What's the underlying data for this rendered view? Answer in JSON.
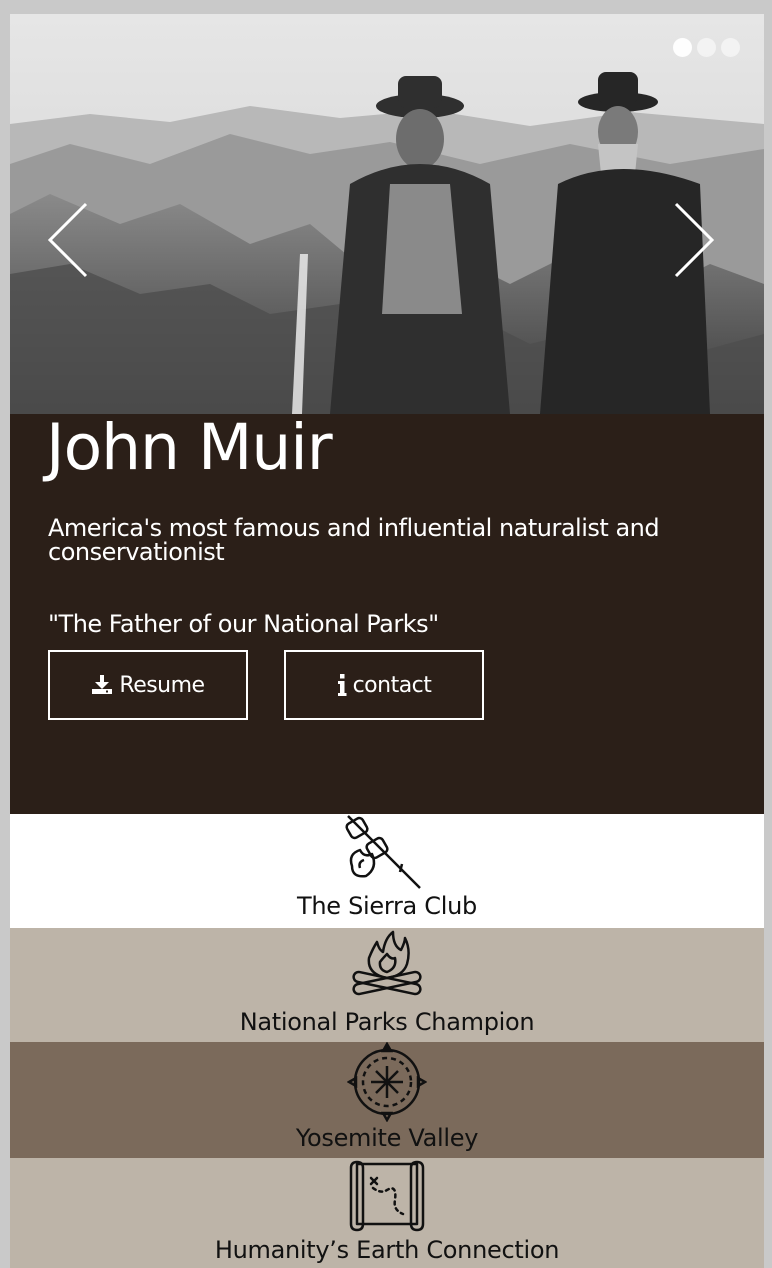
{
  "hero": {
    "slides": 3,
    "active_slide": 1,
    "prev_icon": "chevron-left-icon",
    "next_icon": "chevron-right-icon"
  },
  "intro": {
    "name": "John Muir",
    "tagline": "America's most famous and influential naturalist and conservationist",
    "quote": "\"The Father of our National Parks\"",
    "resume_label": "Resume",
    "resume_icon": "download-icon",
    "contact_label": "contact",
    "contact_icon": "info-icon"
  },
  "features": [
    {
      "label": "The Sierra Club",
      "icon": "marshmallow-skewer-icon",
      "bg": "#ffffff"
    },
    {
      "label": "National Parks Champion",
      "icon": "campfire-icon",
      "bg": "#bdb4a8"
    },
    {
      "label": "Yosemite Valley",
      "icon": "compass-icon",
      "bg": "#7b6a5b"
    },
    {
      "label": "Humanity’s Earth Connection",
      "icon": "treasure-map-icon",
      "bg": "#bdb4a8"
    }
  ],
  "colors": {
    "panel": "#2b1f18",
    "text_light": "#ffffff"
  }
}
